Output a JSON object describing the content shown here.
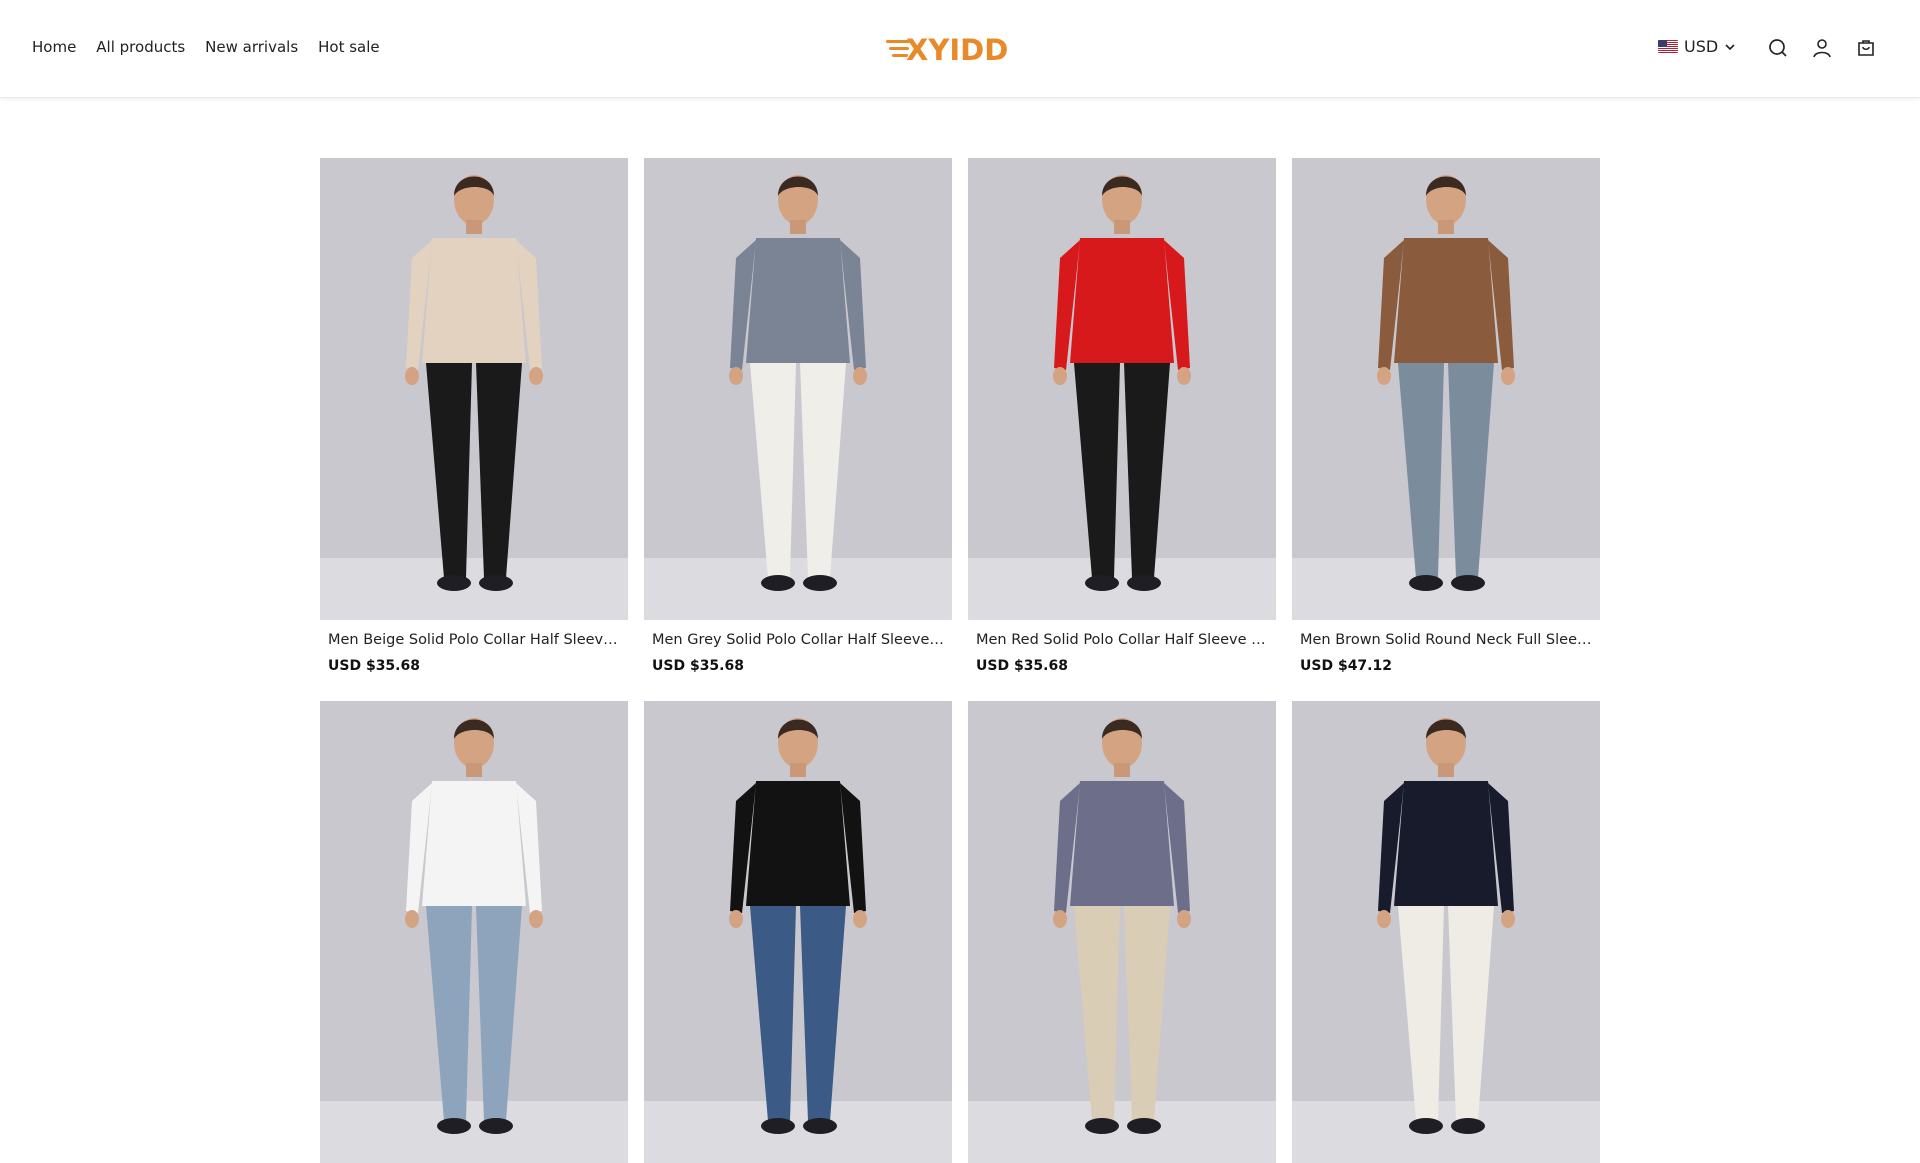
{
  "nav": {
    "items": [
      "Home",
      "All products",
      "New arrivals",
      "Hot sale"
    ]
  },
  "logo": {
    "text": "XYIDD",
    "color": "#e98a2a"
  },
  "currency": {
    "code": "USD",
    "flag": "us-flag-icon"
  },
  "icons": [
    "search-icon",
    "account-icon",
    "cart-icon"
  ],
  "products": [
    {
      "title": "Men Beige Solid Polo Collar Half Sleeve ...",
      "price": "USD $35.68",
      "shirt_color": "#e3d2bf",
      "pants_color": "#1a1a1a"
    },
    {
      "title": "Men Grey Solid Polo Collar Half Sleeve T-...",
      "price": "USD $35.68",
      "shirt_color": "#7a8494",
      "pants_color": "#f0eee9"
    },
    {
      "title": "Men Red Solid Polo Collar Half Sleeve T-...",
      "price": "USD $35.68",
      "shirt_color": "#d8191b",
      "pants_color": "#1a1a1a"
    },
    {
      "title": "Men Brown Solid Round Neck Full Sleev...",
      "price": "USD $47.12",
      "shirt_color": "#8a5b3c",
      "pants_color": "#7b8d9d"
    },
    {
      "title": "",
      "price": "",
      "shirt_color": "#f4f4f4",
      "pants_color": "#8ea4bd"
    },
    {
      "title": "",
      "price": "",
      "shirt_color": "#121212",
      "pants_color": "#3b5a86"
    },
    {
      "title": "",
      "price": "",
      "shirt_color": "#6d6f8a",
      "pants_color": "#d9cdb6"
    },
    {
      "title": "",
      "price": "",
      "shirt_color": "#171b2b",
      "pants_color": "#efece6"
    }
  ]
}
